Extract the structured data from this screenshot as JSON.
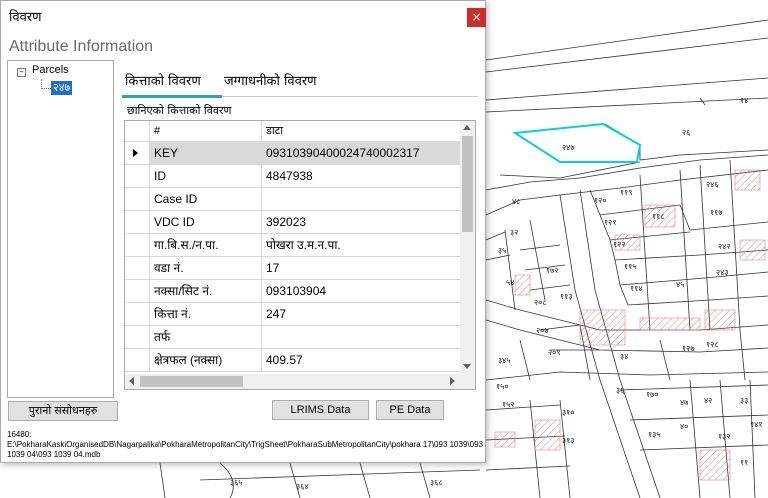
{
  "dialog": {
    "title": "विवरण",
    "close_label": "×",
    "heading": "Attribute Information"
  },
  "tree": {
    "expander": "–",
    "root_label": "Parcels",
    "child_label": "२४७"
  },
  "tabs": [
    {
      "label": "कित्ताको विवरण",
      "active": true
    },
    {
      "label": "जग्गाधनीको विवरण",
      "active": false
    }
  ],
  "section_label": "छानिएको कित्ताको विवरण",
  "grid": {
    "columns": [
      "#",
      "डाटा"
    ],
    "rows": [
      {
        "field": "KEY",
        "value": "09310390400024740002317",
        "selected": true
      },
      {
        "field": "ID",
        "value": "4847938"
      },
      {
        "field": "Case ID",
        "value": ""
      },
      {
        "field": "VDC ID",
        "value": "392023"
      },
      {
        "field": "गा.बि.स./न.पा.",
        "value": "पोखरा उ.म.न.पा."
      },
      {
        "field": "वडा नं.",
        "value": "17"
      },
      {
        "field": "नक्सा/सिट नं.",
        "value": "093103904"
      },
      {
        "field": "कित्ता नं.",
        "value": "247"
      },
      {
        "field": "तर्फ",
        "value": ""
      },
      {
        "field": "क्षेत्रफल (नक्सा)",
        "value": "409.57"
      }
    ]
  },
  "buttons": {
    "old_revisions": "पुरानो संसोधनहरु",
    "lrims_data": "LRIMS Data",
    "pe_data": "PE Data"
  },
  "path_text": "16480:\nE:\\PokharaKaskiOrganisedDB\\Nagarpalika\\PokharaMetropolitanCity\\TrigSheet\\PokharaSubMetropolitanCity\\pokhara 17\\093 1039\\093 1039 04\\093 1039 04.mdb",
  "map": {
    "highlight_color": "#00d4d4",
    "hatch_color": "#e88080",
    "labels": [
      "२४७",
      "२६",
      "१४",
      "११९",
      "१२०",
      "१२१",
      "१२२",
      "११८",
      "११७",
      "२४६",
      "११५",
      "२४२",
      "११४",
      "२४३",
      "११३",
      "२०८",
      "२०७",
      "२०९",
      "३१०",
      "१५०",
      "१५२",
      "३४५",
      "४५",
      "१२७",
      "१२८",
      "३१३",
      "१३२",
      "४८",
      "३२",
      "३५",
      "४७",
      "४२",
      "३३",
      "४०",
      "१७२",
      "५४",
      "३४",
      "३६",
      "३६५",
      "३६४",
      "३६८",
      "११",
      "१३५",
      "१४१",
      "१७०"
    ]
  }
}
